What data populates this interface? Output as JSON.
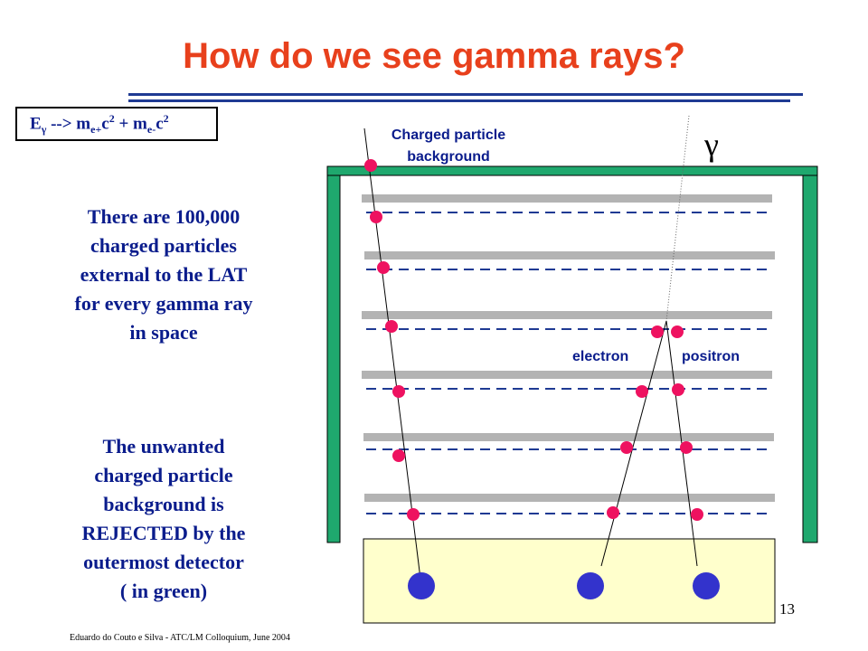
{
  "title": "How do we see gamma rays?",
  "equation": {
    "lhs_main": "E",
    "lhs_sub": "γ",
    "arrow": " --> m",
    "m1_sub": "e+",
    "c1": "c",
    "c1_sup": "2",
    "plus": " + m",
    "m2_sub": "e-",
    "c2": "c",
    "c2_sup": "2"
  },
  "paragraph_1": [
    "There are 100,000",
    "charged particles",
    "external to the LAT",
    "for every gamma ray",
    "in space"
  ],
  "paragraph_2": [
    "The unwanted",
    "charged particle",
    "background is",
    "REJECTED by the",
    "outermost detector",
    "( in green)"
  ],
  "diagram": {
    "label_charged_line1": "Charged particle",
    "label_charged_line2": "background",
    "gamma_symbol": "γ",
    "label_electron": "electron",
    "label_positron": "positron"
  },
  "colors": {
    "title": "#e8401c",
    "text_blue": "#0a1c8c",
    "anticoincidence_green": "#1fa86e",
    "tracker_gray": "#b3b3b3",
    "hit_pink": "#ee1260",
    "calorimeter_yellow": "#ffffcc",
    "calorimeter_hit_blue": "#3333cc"
  },
  "footer": "Eduardo do Couto e Silva - ATC/LM Colloquium, June 2004",
  "page_number": "13"
}
